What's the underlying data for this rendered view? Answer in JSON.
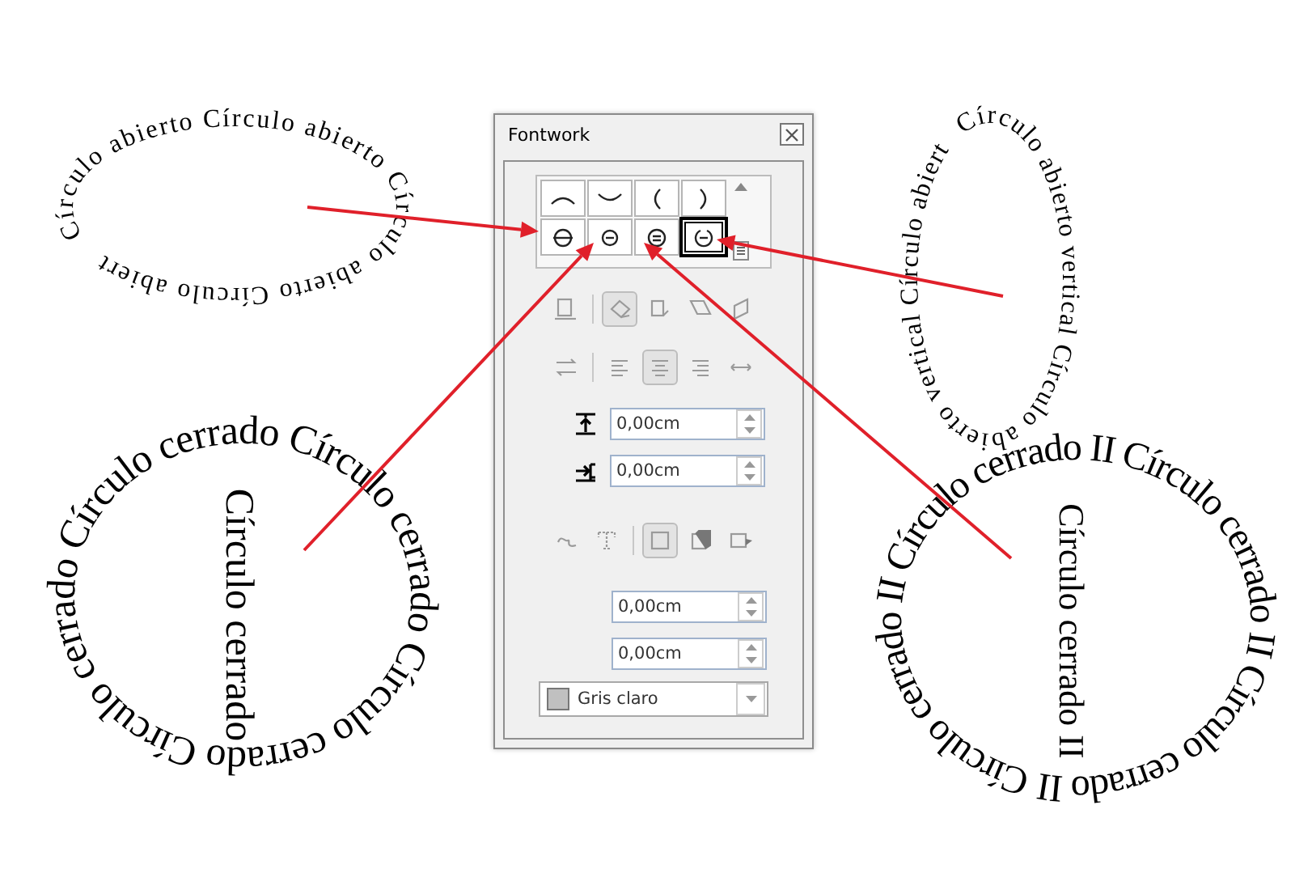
{
  "samples": [
    {
      "kind": "open",
      "text": "Círculo abierto Círculo abierto Círculo abierto Círculo abiert"
    },
    {
      "kind": "closed",
      "text": "Círculo cerrado Círculo cerrado Círculo cerrado Círculo cerrado",
      "inner_text": "Círculo cerrado"
    },
    {
      "kind": "open",
      "text": "Círculo abierto vertical Círculo abierto vertical Círculo abiert"
    },
    {
      "kind": "closed",
      "text": "Círculo cerrado II Círculo cerrado II Círculo cerrado II Círculo cerrado II",
      "inner_text": "Círculo cerrado II"
    }
  ],
  "fontwork_window": {
    "title": "Fontwork",
    "shapes": [
      {
        "kind": "arch-up",
        "selected": false
      },
      {
        "kind": "arch-down",
        "selected": false
      },
      {
        "kind": "open-left",
        "selected": false
      },
      {
        "kind": "open-right",
        "selected": false
      },
      {
        "kind": "circle-bar",
        "selected": false
      },
      {
        "kind": "circle-small",
        "selected": false
      },
      {
        "kind": "circle-double",
        "selected": false
      },
      {
        "kind": "circle-open",
        "selected": true
      }
    ],
    "orientation_tools": [
      {
        "kind": "off",
        "selected": false
      },
      {
        "kind": "rotate",
        "selected": true
      },
      {
        "kind": "upright",
        "selected": false
      },
      {
        "kind": "slant-h",
        "selected": false
      },
      {
        "kind": "slant-v",
        "selected": false
      }
    ],
    "alignment_tools": [
      {
        "kind": "swap",
        "selected": false
      },
      {
        "kind": "left",
        "selected": false
      },
      {
        "kind": "center",
        "selected": true
      },
      {
        "kind": "right",
        "selected": false
      },
      {
        "kind": "stretch",
        "selected": false
      }
    ],
    "distance": {
      "value": "0,00cm"
    },
    "indent": {
      "value": "0,00cm"
    },
    "shadow_tools": [
      {
        "kind": "contour",
        "selected": false
      },
      {
        "kind": "text-frame",
        "selected": false
      },
      {
        "kind": "none",
        "selected": true
      },
      {
        "kind": "vertical",
        "selected": false
      },
      {
        "kind": "slanted",
        "selected": false
      }
    ],
    "shadow_x": {
      "value": "0,00cm"
    },
    "shadow_y": {
      "value": "0,00cm"
    },
    "shadow_color": {
      "value": "Gris claro",
      "color": "#c0c0c0"
    }
  }
}
